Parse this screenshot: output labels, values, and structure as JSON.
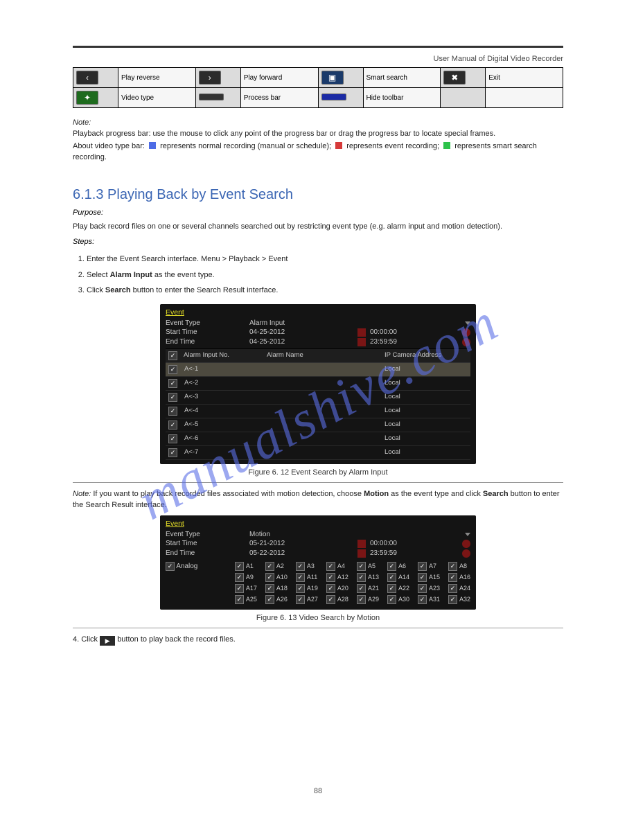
{
  "header_title": "User Manual of Digital Video Recorder",
  "icon_table": {
    "row1": [
      {
        "icon": "‹",
        "desc": "Play reverse"
      },
      {
        "icon": "›",
        "desc": "Play forward"
      },
      {
        "icon_svg": "picture",
        "desc": "Smart search"
      },
      {
        "icon": "✖",
        "desc": "Exit"
      }
    ],
    "row2": [
      {
        "icon_svg": "magic",
        "desc": "Video type"
      },
      {
        "icon_svg": "bar-dark",
        "desc": "Process bar"
      },
      {
        "icon_svg": "bar-blue",
        "desc": "Hide toolbar"
      },
      {
        "icon": "",
        "desc": ""
      }
    ]
  },
  "notes": {
    "label": "Note:",
    "n1": "Playback progress bar: use the mouse to click any point of the progress bar or drag the progress bar to locate special frames.",
    "n2_prefix": "About video type bar: ",
    "n2_blue": " represents normal recording (manual or schedule); ",
    "n2_red": " represents event recording; ",
    "n2_green": " represents smart search recording."
  },
  "section": "6.1.3 Playing Back by Event Search",
  "purpose_hdr": "Purpose:",
  "purpose_text": "Play back record files on one or several channels searched out by restricting event type (e.g. alarm input and motion detection).",
  "steps_hdr": "Steps:",
  "steps": [
    "Enter the Event Search interface.\nMenu > Playback > Event",
    {
      "text_a": "Select ",
      "bold": "Alarm Input",
      "text_b": " as the event type."
    },
    {
      "text_a": "Click ",
      "bold": "Search",
      "text_b": " button to enter the Search Result interface."
    }
  ],
  "panel1": {
    "title": "Event",
    "event_type_lbl": "Event Type",
    "event_type_val": "Alarm Input",
    "start_time_lbl": "Start Time",
    "start_date": "04-25-2012",
    "start_time": "00:00:00",
    "end_time_lbl": "End Time",
    "end_date": "04-25-2012",
    "end_time": "23:59:59",
    "col1": "Alarm Input No.",
    "col2": "Alarm Name",
    "col3": "IP Camera Address",
    "rows": [
      {
        "no": "A<-1",
        "name": "",
        "addr": "Local"
      },
      {
        "no": "A<-2",
        "name": "",
        "addr": "Local"
      },
      {
        "no": "A<-3",
        "name": "",
        "addr": "Local"
      },
      {
        "no": "A<-4",
        "name": "",
        "addr": "Local"
      },
      {
        "no": "A<-5",
        "name": "",
        "addr": "Local"
      },
      {
        "no": "A<-6",
        "name": "",
        "addr": "Local"
      },
      {
        "no": "A<-7",
        "name": "",
        "addr": "Local"
      }
    ]
  },
  "fig1_caption": "Figure 6. 12 Event Search by Alarm Input",
  "note2": {
    "label": "Note:",
    "prefix": "If you want to play back recorded files associated with motion detection, choose ",
    "bold": "Motion",
    "mid": " as the event type and click ",
    "bold2": "Search",
    "suffix": " button to enter the Search Result interface."
  },
  "panel2": {
    "title": "Event",
    "event_type_lbl": "Event Type",
    "event_type_val": "Motion",
    "start_time_lbl": "Start Time",
    "start_date": "05-21-2012",
    "start_time": "00:00:00",
    "end_time_lbl": "End Time",
    "end_date": "05-22-2012",
    "end_time": "23:59:59",
    "analog_lbl": "Analog",
    "channels": [
      "A1",
      "A2",
      "A3",
      "A4",
      "A5",
      "A6",
      "A7",
      "A8",
      "A9",
      "A10",
      "A11",
      "A12",
      "A13",
      "A14",
      "A15",
      "A16",
      "A17",
      "A18",
      "A19",
      "A20",
      "A21",
      "A22",
      "A23",
      "A24",
      "A25",
      "A26",
      "A27",
      "A28",
      "A29",
      "A30",
      "A31",
      "A32"
    ]
  },
  "fig2_caption": "Figure 6. 13 Video Search by Motion",
  "post_note": {
    "prefix": "4.  Click ",
    "icon_desc": "play",
    "suffix": " button to play back the record files."
  },
  "page_number": "88"
}
